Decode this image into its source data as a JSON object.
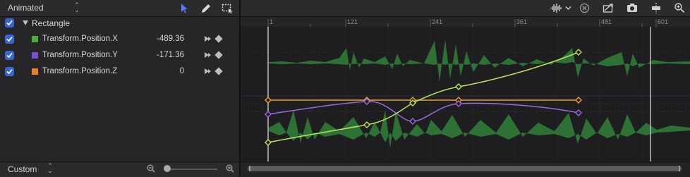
{
  "params_panel": {
    "filter_value": "Animated",
    "group": {
      "label": "Rectangle"
    },
    "channels": [
      {
        "name": "Transform.Position.X",
        "value": "-489.36",
        "color": "#4caf35"
      },
      {
        "name": "Transform.Position.Y",
        "value": "-171.36",
        "color": "#7b4fd1"
      },
      {
        "name": "Transform.Position.Z",
        "value": "0",
        "color": "#e8821e"
      }
    ]
  },
  "bottom_bar": {
    "fit_value": "Custom"
  },
  "ruler": {
    "labels": [
      "1",
      "121",
      "241",
      "361",
      "481",
      "601"
    ]
  },
  "colors": {
    "accent": "#3a63d6",
    "curve_x": "#b8e35a",
    "curve_y": "#9b67e0",
    "curve_z": "#f0a030",
    "waveform": "#2f7a36"
  },
  "icons": {
    "filter_arrows": "updown-chevron-icon",
    "fit_arrows": "updown-chevron-icon",
    "tools": [
      "arrow-pointer-icon",
      "pen-icon",
      "marquee-icon"
    ],
    "right_toolbar": [
      "waveform-icon",
      "clear-icon",
      "snapping-icon",
      "snapshot-camera-icon",
      "clip-center-icon",
      "zoom-to-fit-icon"
    ]
  }
}
